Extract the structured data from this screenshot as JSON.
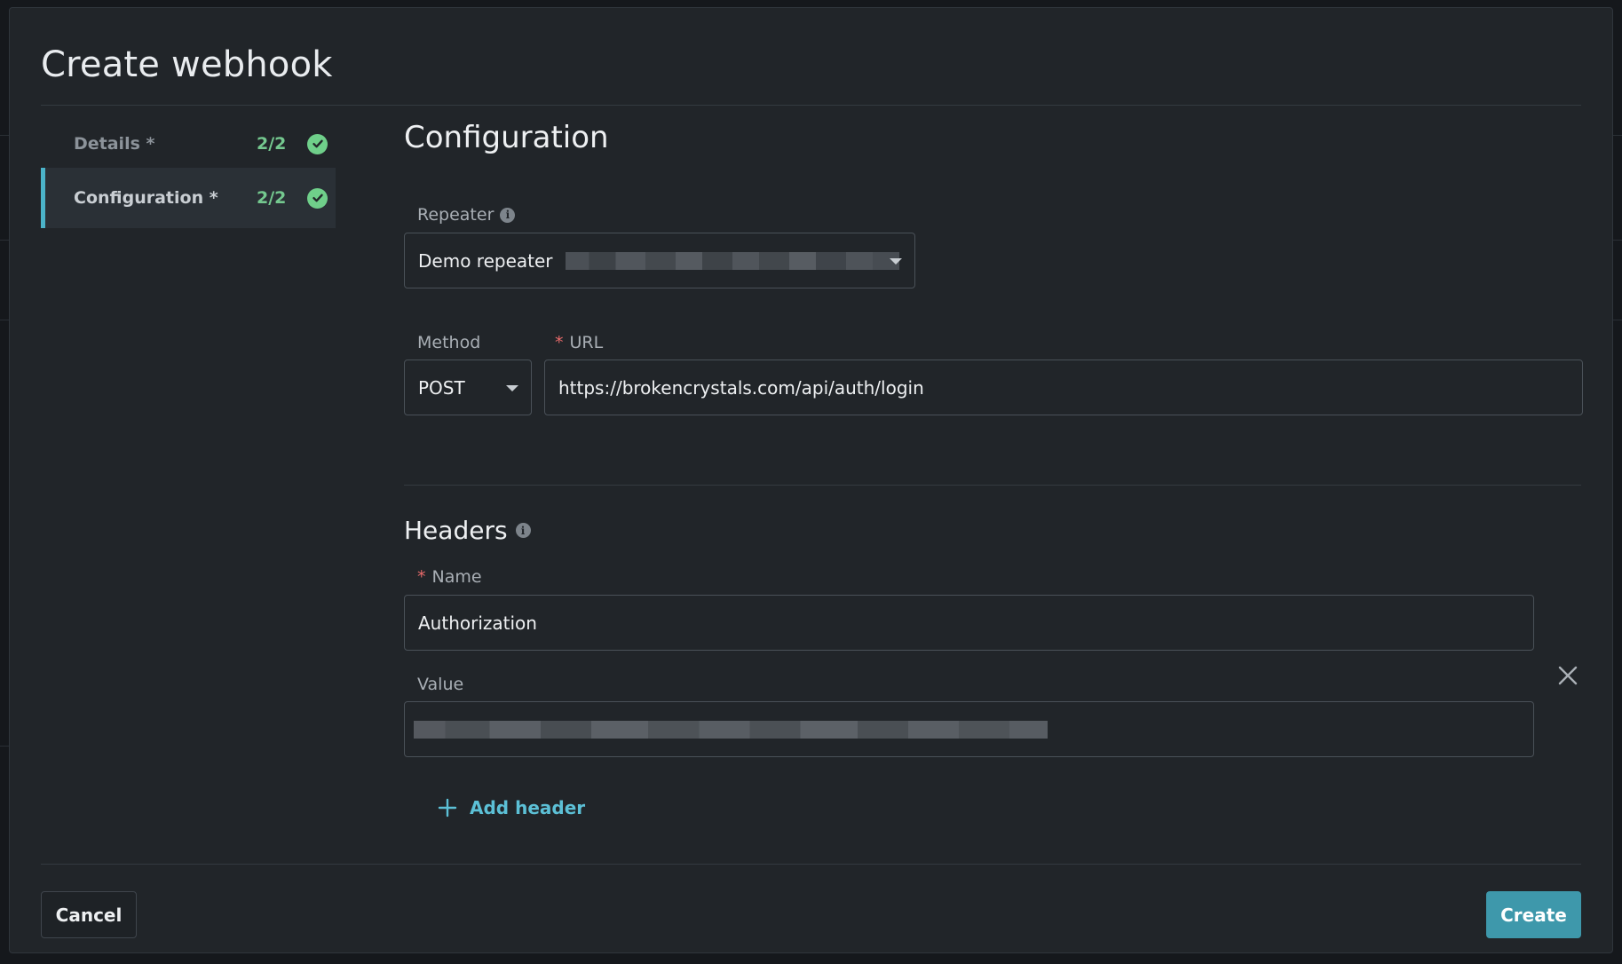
{
  "modal": {
    "title": "Create webhook"
  },
  "steps": [
    {
      "label": "Details *",
      "count": "2/2",
      "complete": true
    },
    {
      "label": "Configuration *",
      "count": "2/2",
      "complete": true,
      "active": true
    }
  ],
  "configuration": {
    "heading": "Configuration",
    "repeater": {
      "label": "Repeater",
      "value": "Demo repeater"
    },
    "method": {
      "label": "Method",
      "value": "POST"
    },
    "url": {
      "required_mark": "*",
      "label": "URL",
      "value": "https://brokencrystals.com/api/auth/login"
    }
  },
  "headers": {
    "heading": "Headers",
    "name": {
      "required_mark": "*",
      "label": "Name",
      "value": "Authorization"
    },
    "value": {
      "label": "Value"
    },
    "add_label": "Add header"
  },
  "footer": {
    "cancel_label": "Cancel",
    "create_label": "Create"
  },
  "colors": {
    "accent": "#4bb3c9",
    "success": "#6fcf8a",
    "primary_button": "#3e98ab",
    "required": "#e86a6a"
  }
}
